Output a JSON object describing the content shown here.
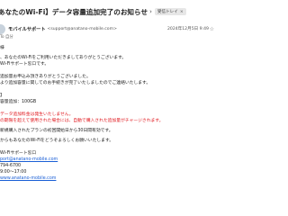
{
  "email": {
    "subject": "あなたのWi-Fi】データ容量追加完了のお知らせ",
    "label": "受信トレイ",
    "sender_name": "モバイルサポート",
    "sender_email": "<support@anatano-mobile.com>",
    "date": "2024年12月5日 9:49",
    "to": "To 自分"
  },
  "body": {
    "greeting": "様",
    "intro1": "、あなたのWi-Fiをご利用いただきましてありがとうございます。",
    "intro2": "Wi-Fiサポート窓口です。",
    "line1": "追加量お申込み頂きありがとうございました。",
    "line2": "より追加容量に関してのお手続きが完了いたしましたのでご連絡いたします。",
    "detail_header": "】",
    "detail_volume": "容量追加：100GB",
    "red1": "データ追加料金は発生いたしません。",
    "red2": "の期限を超えて使用された場合には、自動で購入された追加量がチャージされます。",
    "line3": "新規購入されたプランの初回開始日から30日間有効です。",
    "closing": "からもあなたのWi-Fiをどうぞよろしくお願いいたします。",
    "sig_dept": "Wi-Fiサポート窓口",
    "sig_email": "port@anatano-mobile.com",
    "sig_tel": "794-6700",
    "sig_hours": "9:00～17:00",
    "sig_url": "www.anatano-mobile.com"
  },
  "colors": {
    "accent_red": "#e0151b",
    "link_blue": "#1a5fd6"
  }
}
